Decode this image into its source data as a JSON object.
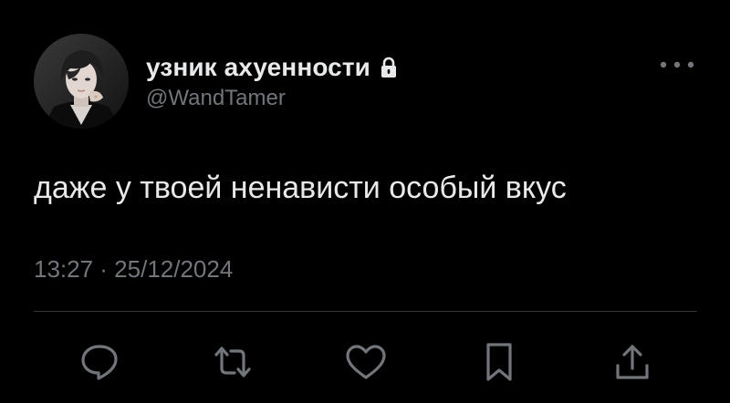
{
  "tweet": {
    "display_name": "узник ахуенности",
    "handle": "@WandTamer",
    "protected_icon": "lock-icon",
    "text": "даже у твоей ненависти особый вкус",
    "timestamp": "13:27 · 25/12/2024",
    "more_icon": "more-dots-icon"
  },
  "actions": [
    {
      "name": "reply",
      "icon": "reply-bubble-icon"
    },
    {
      "name": "retweet",
      "icon": "retweet-icon"
    },
    {
      "name": "like",
      "icon": "heart-icon"
    },
    {
      "name": "bookmark",
      "icon": "bookmark-icon"
    },
    {
      "name": "share",
      "icon": "share-icon"
    }
  ],
  "colors": {
    "background": "#000000",
    "primary_text": "#e7e9ea",
    "secondary_text": "#71767b",
    "divider": "#2f3336",
    "icon": "#71767b"
  }
}
